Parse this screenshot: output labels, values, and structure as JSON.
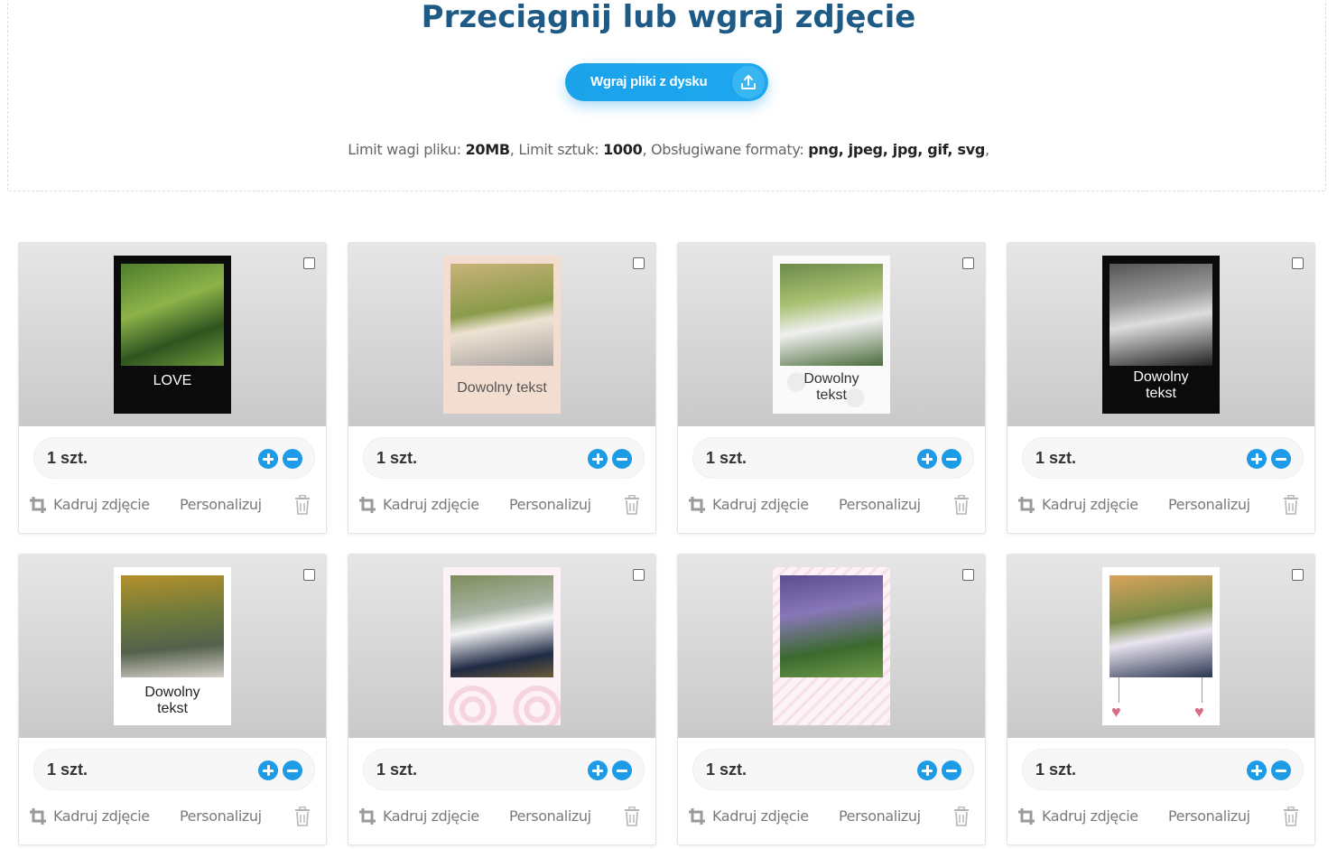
{
  "upload": {
    "title": "Przeciągnij lub wgraj zdjęcie",
    "button_label": "Wgraj pliki z dysku",
    "limits": {
      "weight_label": "Limit wagi pliku: ",
      "weight_value": "20MB",
      "count_label": ", Limit sztuk: ",
      "count_value": "1000",
      "formats_label": ", Obsługiwane formaty: ",
      "formats_value": "png, jpeg, jpg, gif, svg",
      "trailing": ","
    }
  },
  "cards": [
    {
      "qty": "1 szt.",
      "crop": "Kadruj zdjęcie",
      "personalize": "Personalizuj",
      "caption": "LOVE",
      "style": "black-love"
    },
    {
      "qty": "1 szt.",
      "crop": "Kadruj zdjęcie",
      "personalize": "Personalizuj",
      "caption": "Dowolny tekst",
      "style": "peach"
    },
    {
      "qty": "1 szt.",
      "crop": "Kadruj zdjęcie",
      "personalize": "Personalizuj",
      "caption": "Dowolny tekst",
      "style": "white-pattern"
    },
    {
      "qty": "1 szt.",
      "crop": "Kadruj zdjęcie",
      "personalize": "Personalizuj",
      "caption": "Dowolny tekst",
      "style": "black-bw"
    },
    {
      "qty": "1 szt.",
      "crop": "Kadruj zdjęcie",
      "personalize": "Personalizuj",
      "caption": "Dowolny tekst",
      "style": "white"
    },
    {
      "qty": "1 szt.",
      "crop": "Kadruj zdjęcie",
      "personalize": "Personalizuj",
      "caption": "",
      "style": "pink-circles"
    },
    {
      "qty": "1 szt.",
      "crop": "Kadruj zdjęcie",
      "personalize": "Personalizuj",
      "caption": "",
      "style": "pink-chevron"
    },
    {
      "qty": "1 szt.",
      "crop": "Kadruj zdjęcie",
      "personalize": "Personalizuj",
      "caption": "",
      "style": "hearts"
    }
  ],
  "colors": {
    "accent": "#1e9be6",
    "title": "#1d5a86",
    "card_bg_top": "#e6e6e6",
    "card_bg_bottom": "#c9c9c9"
  },
  "icons": {
    "upload": "upload-icon",
    "crop": "crop-icon",
    "delete": "trash-icon",
    "increase": "plus-icon",
    "decrease": "minus-icon"
  }
}
